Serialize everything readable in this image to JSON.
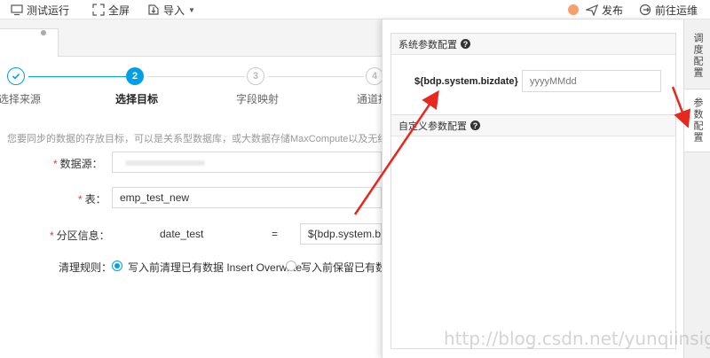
{
  "toolbar": {
    "test_run": "测试运行",
    "fullscreen": "全屏",
    "import": "导入",
    "publish": "发布",
    "goto_ops": "前往运维"
  },
  "steps": [
    {
      "num": "",
      "label": "选择来源",
      "state": "done"
    },
    {
      "num": "2",
      "label": "选择目标",
      "state": "active"
    },
    {
      "num": "3",
      "label": "字段映射",
      "state": "todo"
    },
    {
      "num": "4",
      "label": "通道控",
      "state": "todo"
    }
  ],
  "hint": "您要同步的数据的存放目标，可以是关系型数据库，或大数据存储MaxCompute以及无结构化存储等",
  "form": {
    "datasource_label": "数据源：",
    "table_label": "表：",
    "table_value": "emp_test_new",
    "partition_label": "分区信息：",
    "partition_key": "date_test",
    "partition_eq": "=",
    "partition_value": "${bdp.system.bizdate}",
    "clean_label": "清理规则：",
    "clean_opt1": "写入前清理已有数据 Insert Overwrite",
    "clean_opt2": "写入前保留已有数据"
  },
  "panel": {
    "sys_title": "系统参数配置",
    "sys_param_name": "${bdp.system.bizdate}",
    "sys_param_placeholder": "yyyyMMdd",
    "custom_title": "自定义参数配置"
  },
  "side_tabs": [
    {
      "label": "调度配置",
      "active": false
    },
    {
      "label": "参数配置",
      "active": true
    }
  ],
  "watermark": "http://blog.csdn.net/yunqiinsight",
  "colors": {
    "accent": "#00a0e9",
    "arrow": "#e8281e",
    "required": "#e53935"
  }
}
